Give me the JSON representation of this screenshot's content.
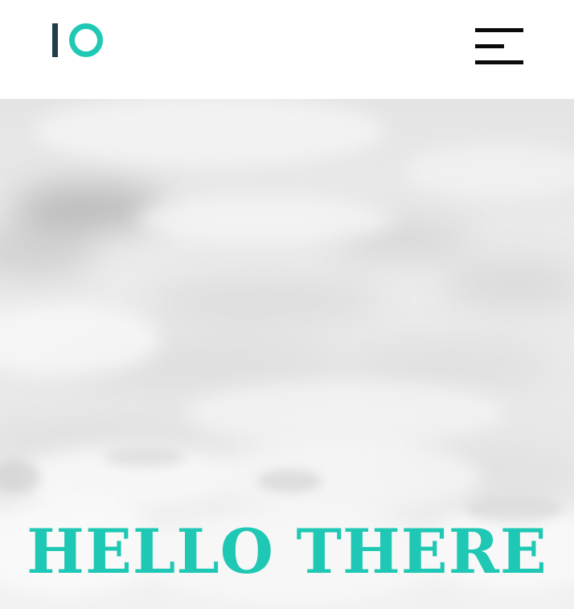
{
  "colors": {
    "accent": "#1ec8b4",
    "logo_dark": "#1f3d4a",
    "menu_icon": "#0a0a0a",
    "header_bg": "#ffffff",
    "sky_base": "#eaeaea"
  },
  "header": {
    "logo_icon": "io-logo-icon",
    "menu_icon": "hamburger-menu-icon"
  },
  "hero": {
    "background": "cloudy-sky-image",
    "title": "HELLO THERE"
  }
}
